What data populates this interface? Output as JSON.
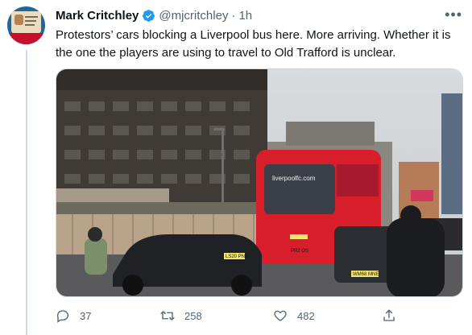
{
  "tweet": {
    "author_name": "Mark Critchley",
    "handle": "@mjcritchley",
    "separator": "·",
    "time": "1h",
    "text": "Protestors’ cars blocking a Liverpool bus here. More arriving. Whether it is the one the players are using to travel to Old Trafford is unclear.",
    "more_icon": "more-horizontal-icon",
    "verified_icon": "verified-badge-icon"
  },
  "media": {
    "bus_destination": "liverpoolfc.com",
    "bus_plate": "PR2 OS",
    "car_left_plate": "LS20 PNO",
    "car_right_plate": "WM68 MNE"
  },
  "actions": {
    "replies": "37",
    "retweets": "258",
    "likes": "482"
  },
  "colors": {
    "text": "#0f1419",
    "secondary": "#536471",
    "verified": "#1d9bf0",
    "bus_red": "#d81e2a"
  }
}
